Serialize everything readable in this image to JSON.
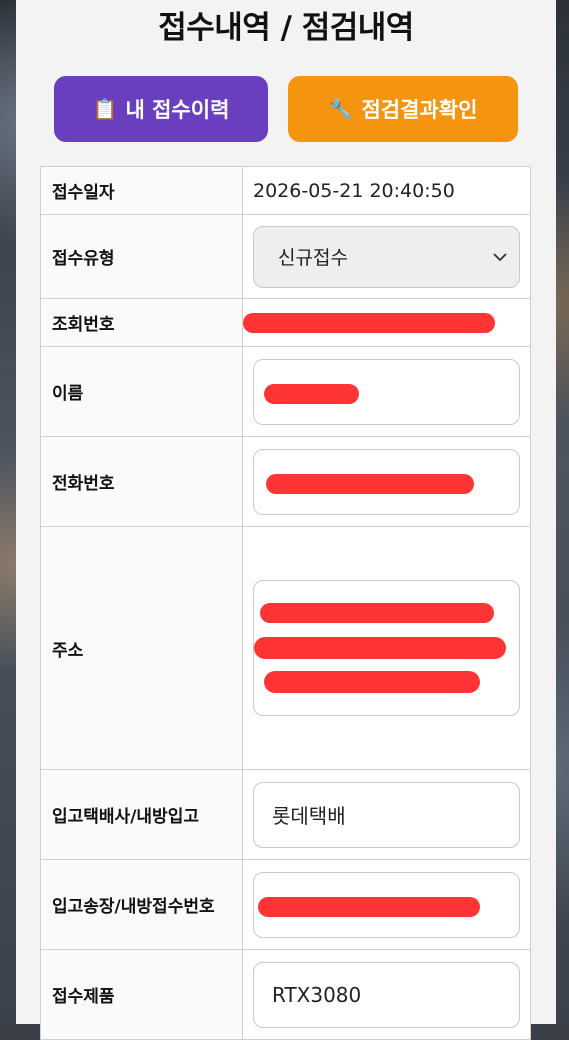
{
  "header": {
    "title": "접수내역 / 점검내역"
  },
  "buttons": {
    "history": {
      "icon": "📋",
      "label": "내 접수이력"
    },
    "result": {
      "icon": "🔧",
      "label": "점검결과확인"
    }
  },
  "form": {
    "date": {
      "label": "접수일자",
      "value": "2026-05-21 20:40:50"
    },
    "type": {
      "label": "접수유형",
      "selected": "신규접수"
    },
    "lookup": {
      "label": "조회번호"
    },
    "name": {
      "label": "이름"
    },
    "phone": {
      "label": "전화번호"
    },
    "address": {
      "label": "주소"
    },
    "courier": {
      "label": "입고택배사/내방입고",
      "value": "롯데택배"
    },
    "tracking": {
      "label": "입고송장/내방접수번호"
    },
    "product": {
      "label": "접수제품",
      "value": "RTX3080"
    }
  },
  "colors": {
    "purple_button": "#6a3fbf",
    "orange_button": "#f5940f",
    "redaction": "#ff3434"
  },
  "icons": {
    "history": "clipboard-icon",
    "result": "wrench-icon",
    "select": "chevron-down-icon"
  }
}
